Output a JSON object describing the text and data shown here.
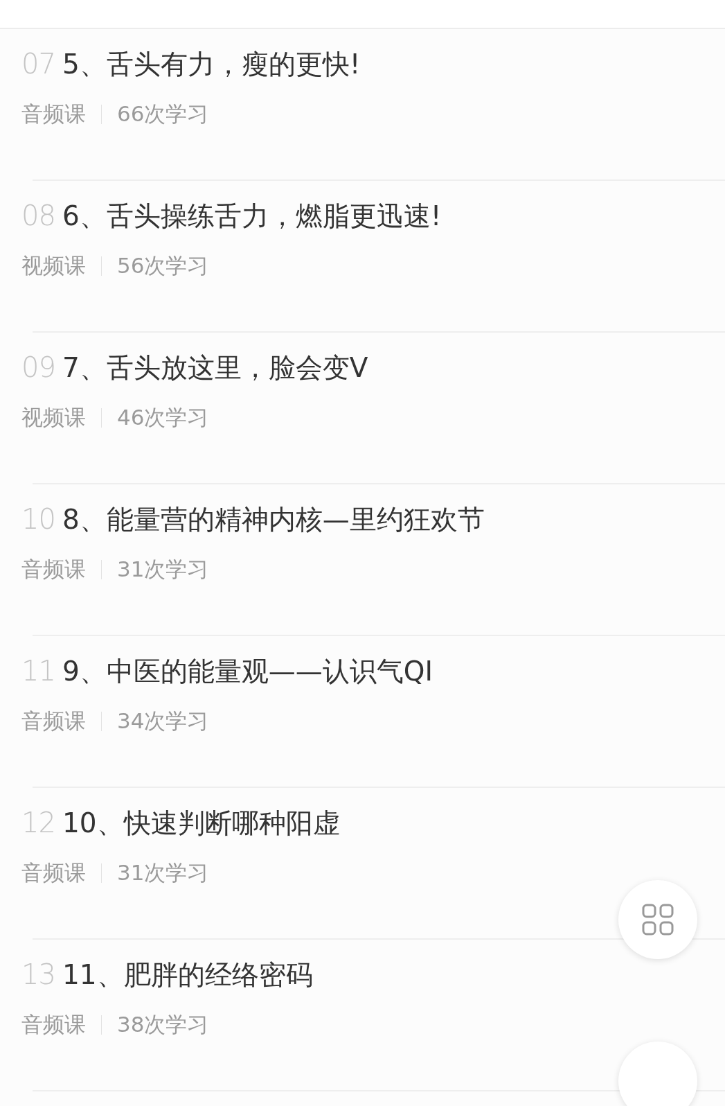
{
  "lessons": [
    {
      "index": "07",
      "title": "5、舌头有力，瘦的更快!",
      "type": "音频课",
      "views": "66次学习"
    },
    {
      "index": "08",
      "title": "6、舌头操练舌力，燃脂更迅速!",
      "type": "视频课",
      "views": "56次学习"
    },
    {
      "index": "09",
      "title": "7、舌头放这里，脸会变V",
      "type": "视频课",
      "views": "46次学习"
    },
    {
      "index": "10",
      "title": "8、能量营的精神内核—里约狂欢节",
      "type": "音频课",
      "views": "31次学习"
    },
    {
      "index": "11",
      "title": "9、中医的能量观——认识气QI",
      "type": "音频课",
      "views": "34次学习"
    },
    {
      "index": "12",
      "title": "10、快速判断哪种阳虚",
      "type": "音频课",
      "views": "31次学习"
    },
    {
      "index": "13",
      "title": "11、肥胖的经络密码",
      "type": "音频课",
      "views": "38次学习"
    }
  ]
}
